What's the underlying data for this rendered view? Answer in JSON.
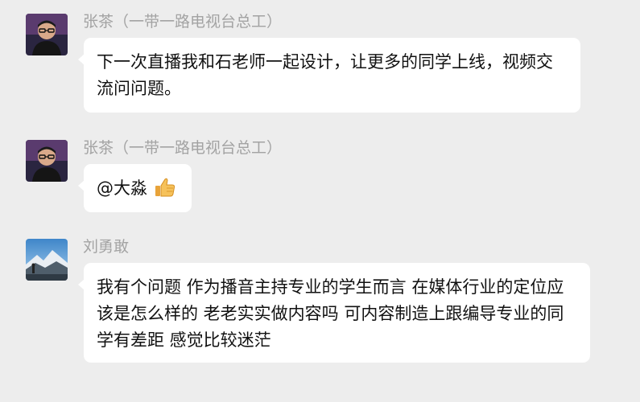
{
  "messages": [
    {
      "sender": "张茶（一带一路电视台总工）",
      "avatar": "man-glasses-avatar",
      "text": "下一次直播我和石老师一起设计，让更多的同学上线，视频交流问问题。"
    },
    {
      "sender": "张茶（一带一路电视台总工）",
      "avatar": "man-glasses-avatar",
      "text": "@大淼",
      "emoji": "thumbs-up-icon"
    },
    {
      "sender": "刘勇敢",
      "avatar": "mountain-landscape-avatar",
      "text": "我有个问题 作为播音主持专业的学生而言 在媒体行业的定位应该是怎么样的 老老实实做内容吗 可内容制造上跟编导专业的同学有差距 感觉比较迷茫"
    }
  ],
  "colors": {
    "background": "#ededed",
    "bubble": "#ffffff",
    "sender_name": "#a3a3a3",
    "message_text": "#111111"
  }
}
